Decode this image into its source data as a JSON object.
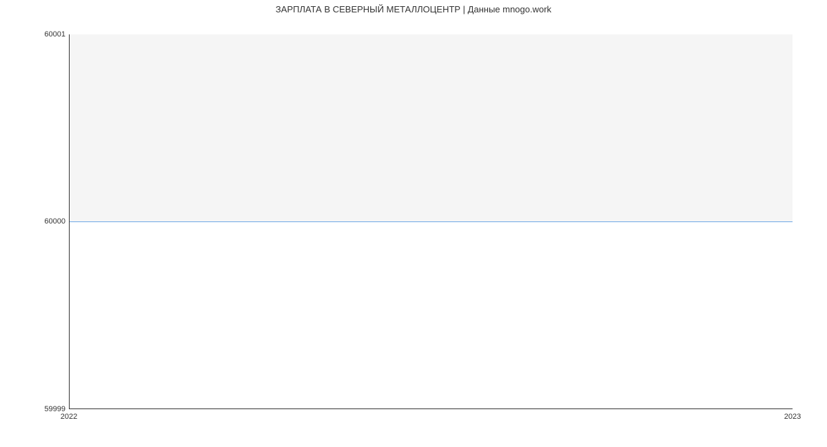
{
  "chart_data": {
    "type": "line",
    "title": "ЗАРПЛАТА В СЕВЕРНЫЙ МЕТАЛЛОЦЕНТР | Данные mnogo.work",
    "xlabel": "",
    "ylabel": "",
    "x": [
      "2022",
      "2023"
    ],
    "values": [
      60000,
      60000
    ],
    "ylim": [
      59999,
      60001
    ],
    "y_ticks": [
      "59999",
      "60000",
      "60001"
    ],
    "x_ticks": [
      "2022",
      "2023"
    ],
    "line_color": "#6ea8e6",
    "grid": false
  }
}
